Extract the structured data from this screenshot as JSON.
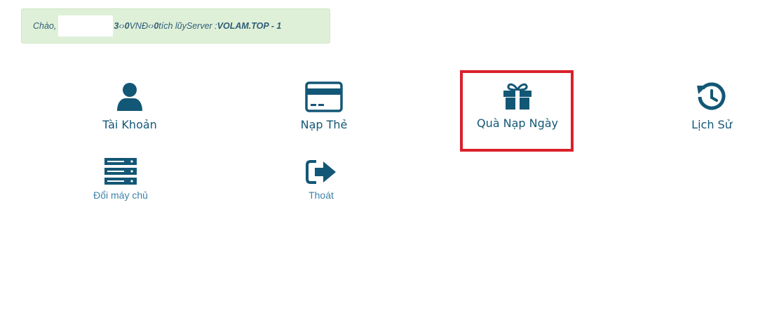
{
  "greeting": {
    "prefix": "Chào,",
    "after_mask": "3",
    "sep1": " ‹› ",
    "vnd_amount": "0",
    "vnd_label": " VNĐ ",
    "sep2": "‹› ",
    "points_amount": "0",
    "points_label": " tích lũy",
    "server_label": "Server : ",
    "server_name": "VOLAM.TOP - 1"
  },
  "menu": {
    "account_label": "Tài Khoản",
    "topup_label": "Nạp Thẻ",
    "daily_gift_label": "Quà Nạp Ngày",
    "history_label": "Lịch Sử",
    "switch_server_label": "Đổi máy chủ",
    "logout_label": "Thoát"
  },
  "icons": {
    "account": "user-icon",
    "topup": "credit-card-icon",
    "daily_gift": "gift-icon",
    "history": "history-icon",
    "switch_server": "server-icon",
    "logout": "sign-out-icon"
  },
  "colors": {
    "icon": "#135776",
    "label": "#135776",
    "small_label": "#3b82a8",
    "alert_bg": "#dff0d8",
    "highlight": "#d9212b"
  }
}
